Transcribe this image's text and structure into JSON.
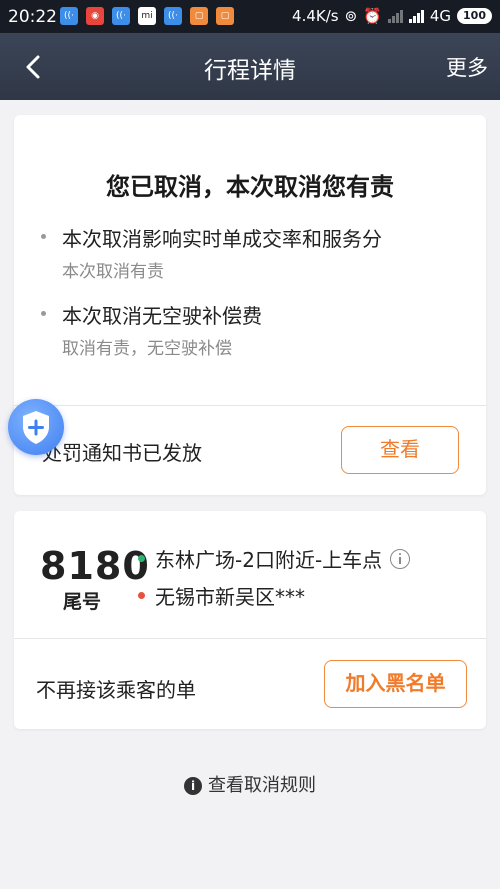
{
  "status_bar": {
    "time": "20:22",
    "network_speed": "4.4K/s",
    "network_type": "4G",
    "battery": "100",
    "notification_icons": [
      "wifi-app-icon",
      "red-app-icon",
      "wifi-app-icon",
      "mi-app-icon",
      "wifi-app-icon",
      "orange-app-icon",
      "orange-app-icon"
    ]
  },
  "nav": {
    "title": "行程详情",
    "more_label": "更多",
    "bar_color": "#38404f"
  },
  "cancel_card": {
    "heading": "您已取消，本次取消您有责",
    "items": [
      {
        "title": "本次取消影响实时单成交率和服务分",
        "subtitle": "本次取消有责"
      },
      {
        "title": "本次取消无空驶补偿费",
        "subtitle": "取消有责，无空驶补偿"
      }
    ],
    "notice_text": "处罚通知书已发放",
    "view_button_label": "查看"
  },
  "trip_card": {
    "tail_number": "8180",
    "tail_label": "尾号",
    "pickup": "东林广场-2口附近-上车点",
    "dropoff": "无锡市新吴区***",
    "pickup_color": "#2bb573",
    "dropoff_color": "#e5533c",
    "block_text": "不再接该乘客的单",
    "blacklist_button_label": "加入黑名单"
  },
  "footer": {
    "rules_link": "查看取消规则"
  },
  "accent_color": "#f07b2a"
}
